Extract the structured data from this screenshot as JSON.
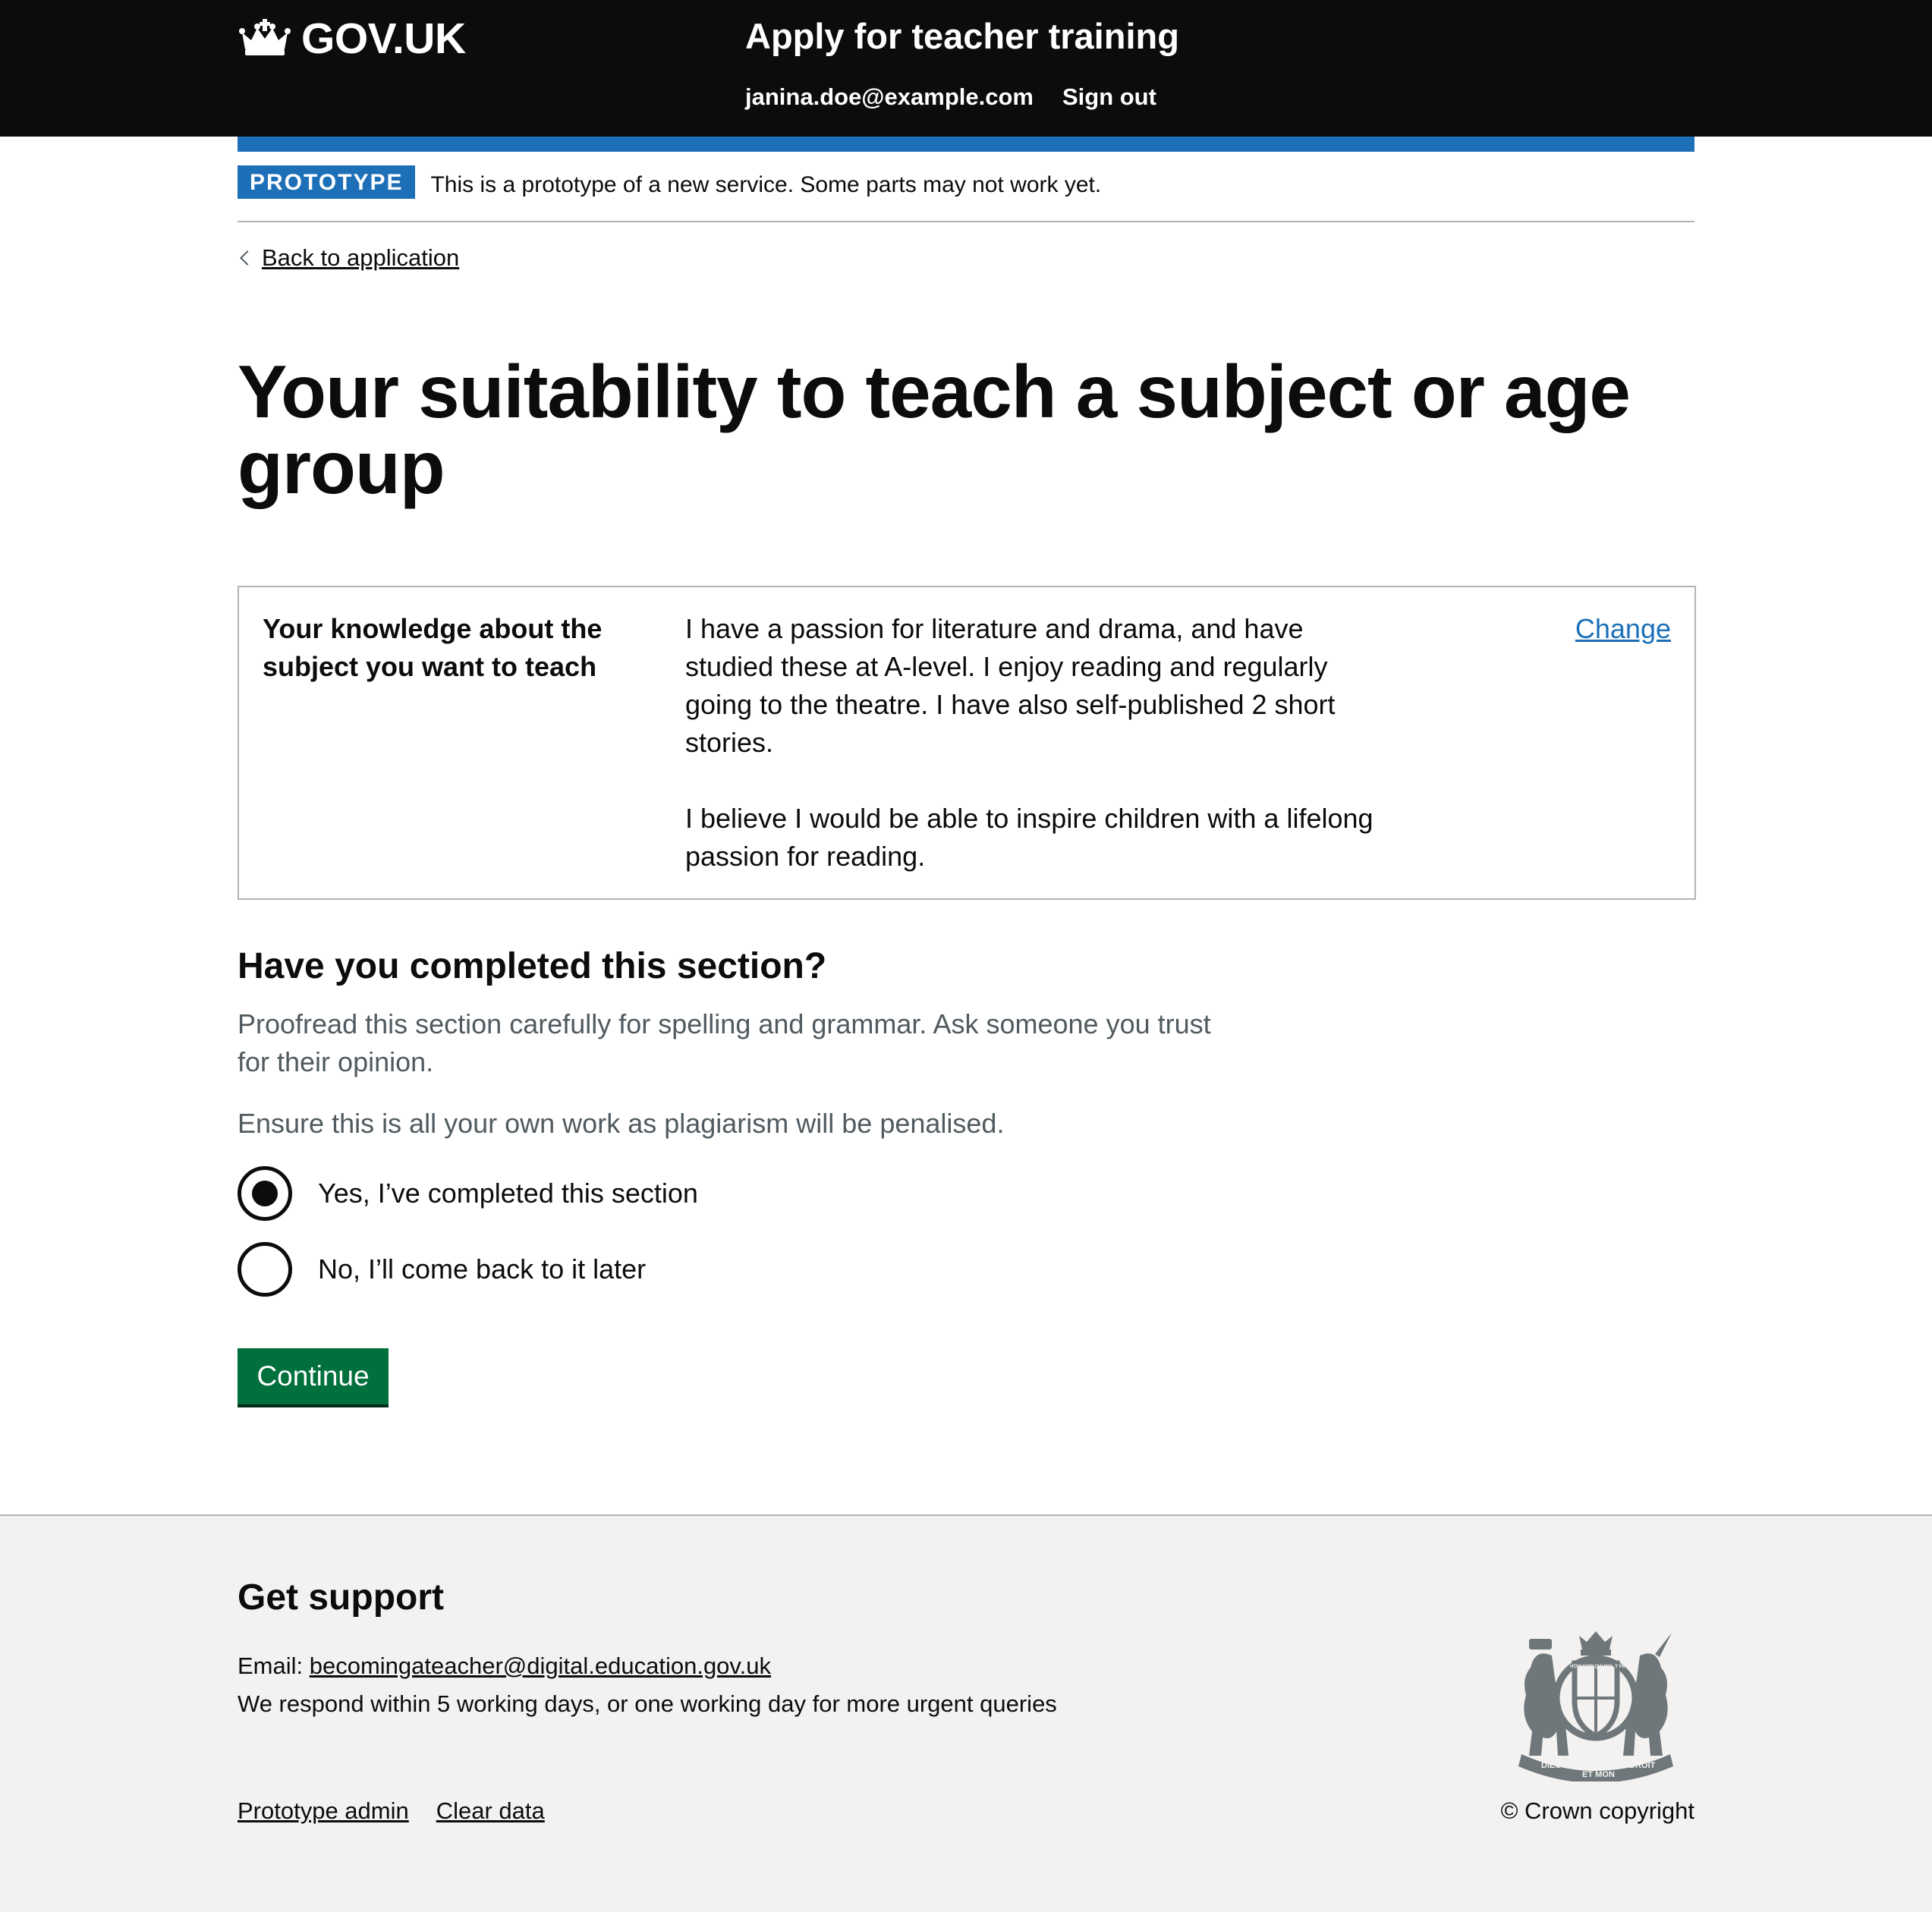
{
  "header": {
    "logo_text": "GOV.UK",
    "service_name": "Apply for teacher training",
    "nav": {
      "email": "janina.doe@example.com",
      "sign_out": "Sign out"
    }
  },
  "phase_banner": {
    "tag": "PROTOTYPE",
    "text": "This is a prototype of a new service. Some parts may not work yet."
  },
  "back_link": "Back to application",
  "page_title": "Your suitability to teach a subject or age group",
  "summary": {
    "key": "Your knowledge about the subject you want to teach",
    "value_paragraphs": [
      "I have a passion for literature and drama, and have studied these at A-level. I enjoy reading and regularly going to the theatre. I have also self-published 2 short stories.",
      "I believe I would be able to inspire children with a lifelong passion for reading."
    ],
    "action": "Change"
  },
  "completion": {
    "heading": "Have you completed this section?",
    "hints": [
      "Proofread this section carefully for spelling and grammar. Ask someone you trust for their opinion.",
      "Ensure this is all your own work as plagiarism will be penalised."
    ],
    "options": [
      {
        "label": "Yes, I’ve completed this section",
        "checked": true
      },
      {
        "label": "No, I’ll come back to it later",
        "checked": false
      }
    ],
    "button": "Continue"
  },
  "footer": {
    "heading": "Get support",
    "email_label": "Email: ",
    "email": "becomingateacher@digital.education.gov.uk",
    "response_text": "We respond within 5 working days, or one working day for more urgent queries",
    "links": [
      "Prototype admin",
      "Clear data"
    ],
    "copyright": "© Crown copyright",
    "crest_motto": [
      "DIEU",
      "ET MON",
      "DROIT"
    ],
    "crest_garter_text": "HONI SOIT QUI MAL Y PENSE"
  },
  "colors": {
    "header_bg": "#0b0c0c",
    "brand_blue": "#1d70b8",
    "button_green": "#00703c",
    "hint_grey": "#505a5f",
    "footer_bg": "#f3f2f1"
  }
}
